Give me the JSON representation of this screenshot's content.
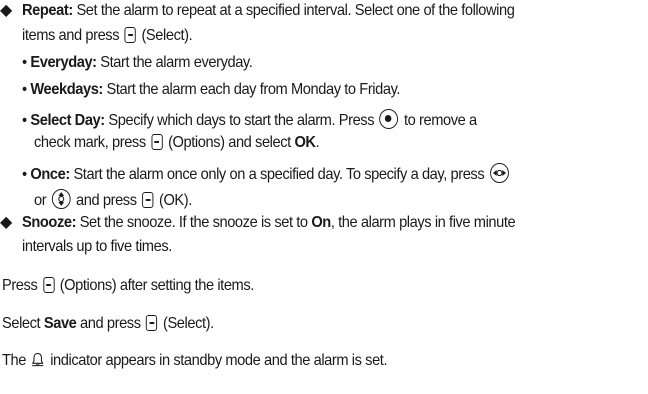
{
  "repeat": {
    "label": "Repeat:",
    "line1": " Set the alarm to repeat at a specified interval. Select one of the following",
    "line2a": "items and press",
    "line2b": " (Select).",
    "everyday": {
      "label": "Everyday:",
      "text": " Start the alarm everyday."
    },
    "weekdays": {
      "label": "Weekdays:",
      "text": " Start the alarm each day from Monday to Friday."
    },
    "select_day": {
      "label": "Select Day:",
      "line1": " Specify which days to start the alarm. Press",
      "line1b": " to remove a",
      "line2a": "check mark, press",
      "line2b": " (Options) and select ",
      "ok": "OK",
      "line2c": "."
    },
    "once": {
      "label": "Once:",
      "line1": " Start the alarm once only on a specified day. To specify a day, press",
      "line2a": "or",
      "line2b": " and press",
      "line2c": " (OK)."
    }
  },
  "snooze": {
    "label": "Snooze:",
    "line1a": " Set the snooze. If the snooze is set to ",
    "on": "On",
    "line1b": ", the alarm plays in five minute",
    "line2": "intervals up to five times."
  },
  "step_press": {
    "a": "Press",
    "b": " (Options) after setting the items."
  },
  "step_save": {
    "a": "Select ",
    "save": "Save",
    "b": " and press",
    "c": " (Select)."
  },
  "step_indicator": {
    "a": "The",
    "b": " indicator appears in standby mode and the alarm is set."
  }
}
